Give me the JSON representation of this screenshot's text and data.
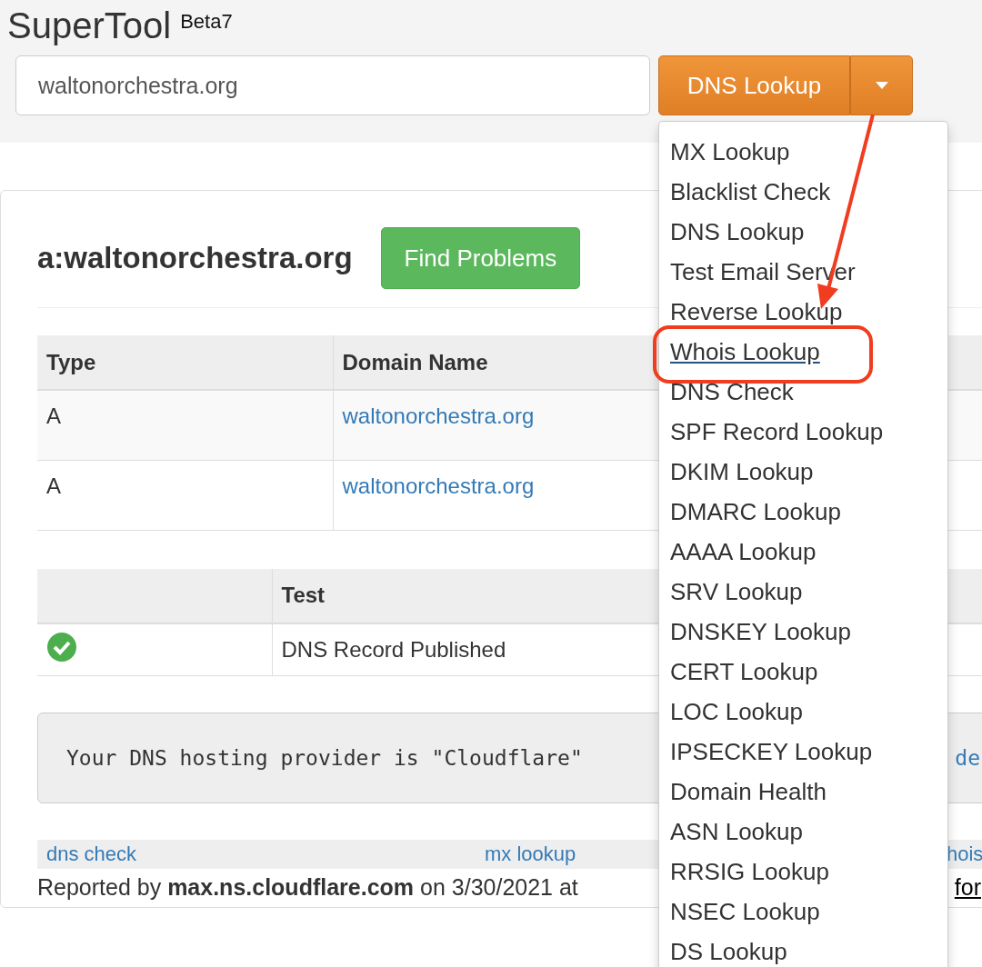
{
  "header": {
    "title": "SuperTool",
    "badge": "Beta7"
  },
  "search": {
    "value": "waltonorchestra.org"
  },
  "action_button": {
    "label": "DNS Lookup"
  },
  "dropdown": {
    "items": [
      {
        "label": "MX Lookup",
        "selected": false
      },
      {
        "label": "Blacklist Check",
        "selected": false
      },
      {
        "label": "DNS Lookup",
        "selected": false
      },
      {
        "label": "Test Email Server",
        "selected": false
      },
      {
        "label": "Reverse Lookup",
        "selected": false
      },
      {
        "label": "Whois Lookup",
        "selected": true
      },
      {
        "label": "DNS Check",
        "selected": false
      },
      {
        "label": "SPF Record Lookup",
        "selected": false
      },
      {
        "label": "DKIM Lookup",
        "selected": false
      },
      {
        "label": "DMARC Lookup",
        "selected": false
      },
      {
        "label": "AAAA Lookup",
        "selected": false
      },
      {
        "label": "SRV Lookup",
        "selected": false
      },
      {
        "label": "DNSKEY Lookup",
        "selected": false
      },
      {
        "label": "CERT Lookup",
        "selected": false
      },
      {
        "label": "LOC Lookup",
        "selected": false
      },
      {
        "label": "IPSECKEY Lookup",
        "selected": false
      },
      {
        "label": "Domain Health",
        "selected": false
      },
      {
        "label": "ASN Lookup",
        "selected": false
      },
      {
        "label": "RRSIG Lookup",
        "selected": false
      },
      {
        "label": "NSEC Lookup",
        "selected": false
      },
      {
        "label": "DS Lookup",
        "selected": false
      }
    ]
  },
  "result": {
    "heading": "a:waltonorchestra.org",
    "find_button": "Find Problems",
    "records_table": {
      "columns": [
        "Type",
        "Domain Name"
      ],
      "rows": [
        [
          "A",
          "waltonorchestra.org"
        ],
        [
          "A",
          "waltonorchestra.org"
        ]
      ]
    },
    "tests_table": {
      "columns": [
        "",
        "Test"
      ],
      "rows": [
        {
          "passed": true,
          "test": "DNS Record Published"
        }
      ]
    },
    "message": {
      "text": "Your DNS hosting provider is \"Cloudflare\"",
      "link_fragment": "de"
    },
    "footer_links": [
      "dns check",
      "mx lookup",
      "hois"
    ],
    "reported": {
      "text": "Reported by **max.ns.cloudflare.com** on 3/30/2021 at",
      "link_fragment": "for"
    }
  }
}
